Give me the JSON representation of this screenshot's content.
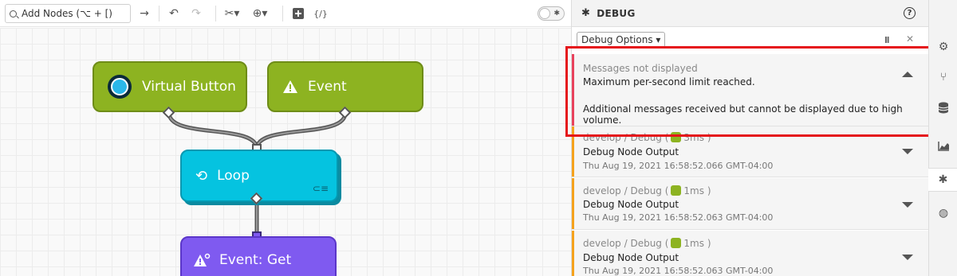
{
  "toolbar": {
    "search_placeholder": "Add Nodes (⌥ + [)"
  },
  "nodes": {
    "virtual_button": "Virtual Button",
    "event": "Event",
    "loop": "Loop",
    "event_get": "Event: Get"
  },
  "debug": {
    "title": "DEBUG",
    "options_label": "Debug Options ▾",
    "messages": [
      {
        "header": "Messages not displayed",
        "title": "Maximum per-second limit reached.",
        "body": "Additional messages received but cannot be displayed due to high volume.",
        "color": "#e8425c"
      },
      {
        "source": "develop / Debug (",
        "duration": "3ms )",
        "title": "Debug Node Output",
        "timestamp": "Thu Aug 19, 2021 16:58:52.066 GMT-04:00",
        "color": "#f5a21c"
      },
      {
        "source": "develop / Debug (",
        "duration": "1ms )",
        "title": "Debug Node Output",
        "timestamp": "Thu Aug 19, 2021 16:58:52.063 GMT-04:00",
        "color": "#f5a21c"
      },
      {
        "source": "develop / Debug (",
        "duration": "1ms )",
        "title": "Debug Node Output",
        "timestamp": "Thu Aug 19, 2021 16:58:52.063 GMT-04:00",
        "color": "#f5a21c"
      }
    ]
  },
  "colors": {
    "accent_red": "#e5141a",
    "node_green": "#8db321",
    "node_cyan": "#05c3e0",
    "node_purple": "#7f5af0"
  },
  "rail": [
    "gear-icon",
    "branch-icon",
    "database-icon",
    "chart-icon",
    "bug-icon",
    "globe-icon"
  ]
}
